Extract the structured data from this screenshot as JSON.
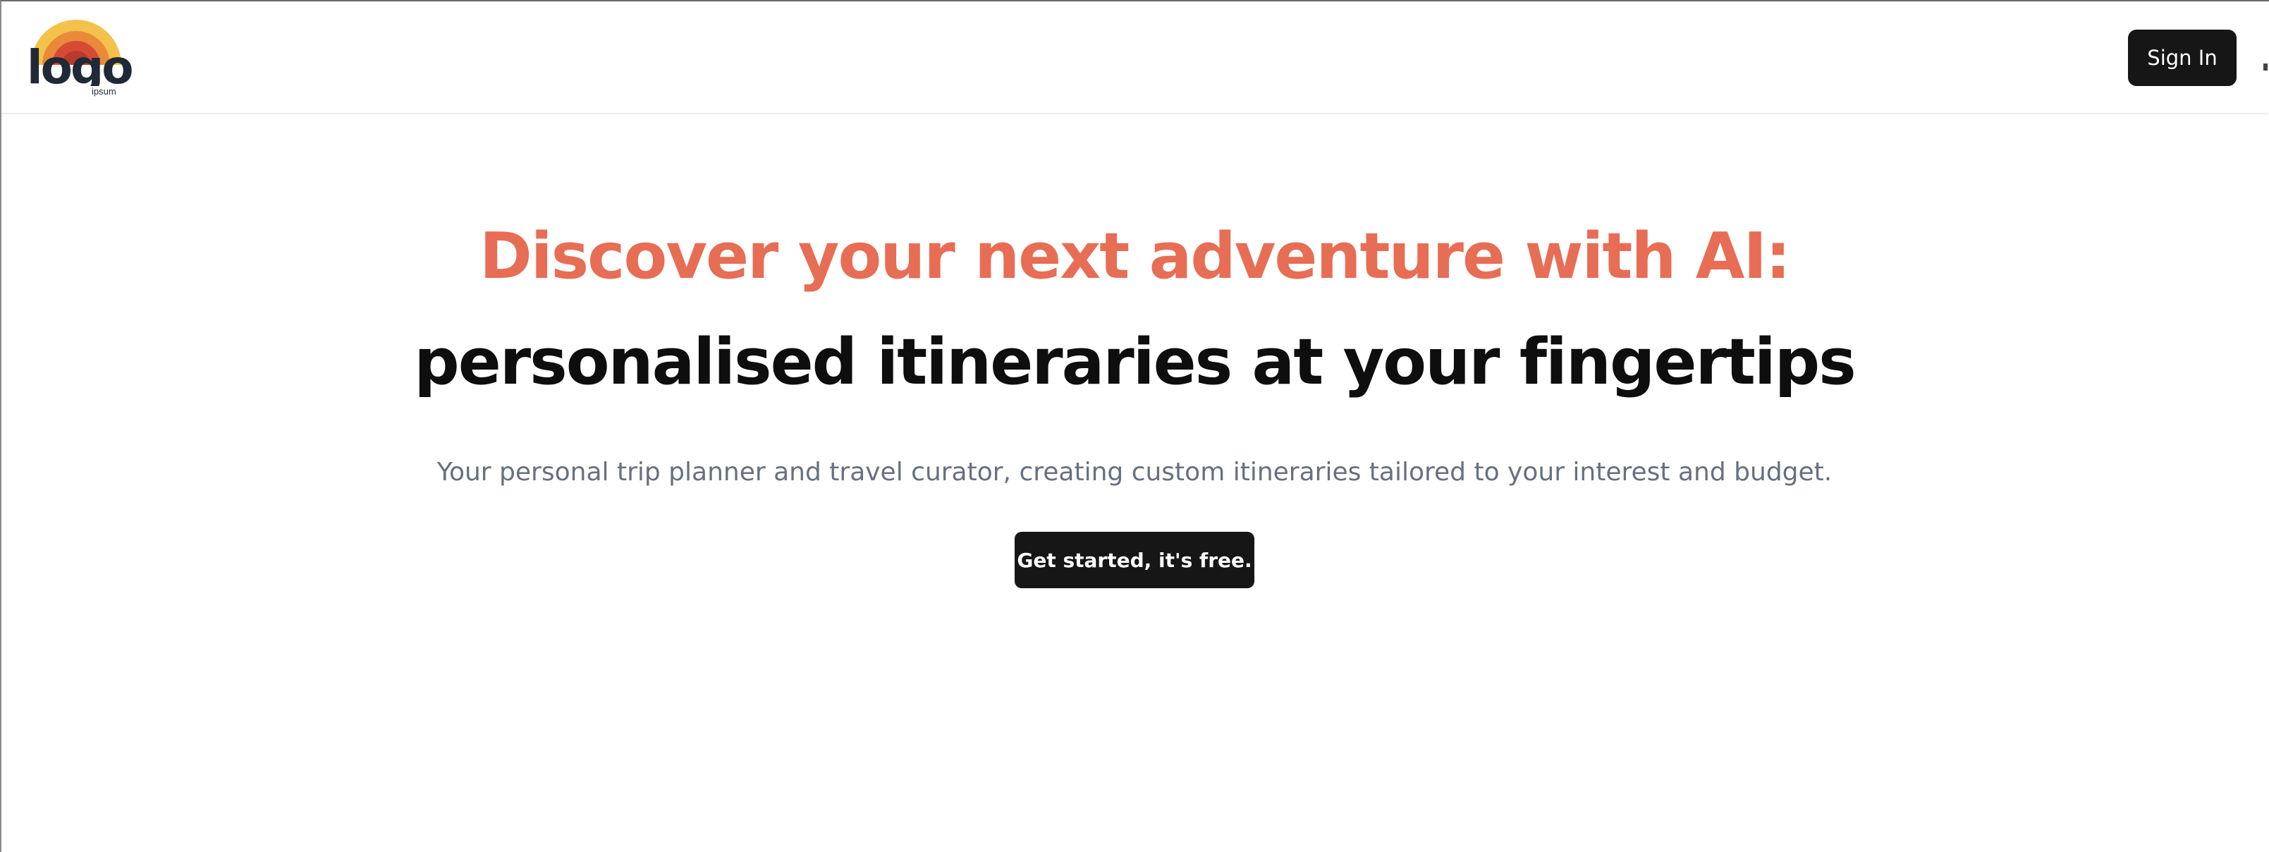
{
  "header": {
    "logo_text": "logo",
    "logo_subtext": "ipsum",
    "signin_label": "Sign In"
  },
  "hero": {
    "headline_accent": "Discover your next adventure with AI:",
    "headline_main": "personalised itineraries at your fingertips",
    "subtitle": "Your personal trip planner and travel curator, creating custom itineraries tailored to your interest and budget.",
    "cta_label": "Get started, it's free."
  },
  "colors": {
    "accent": "#e76d55",
    "button_bg": "#161616",
    "subtitle": "#667080",
    "logo_yellow": "#f4c24a",
    "logo_orange": "#e98a3b",
    "logo_red": "#d64a36",
    "logo_dark": "#1f2a36"
  },
  "icons": {
    "logo": "logo-icon"
  }
}
